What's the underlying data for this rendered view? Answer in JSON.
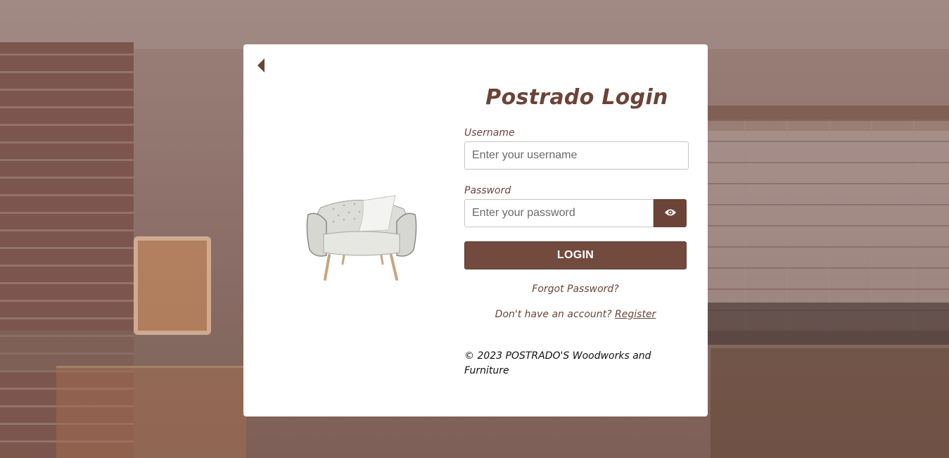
{
  "login": {
    "title": "Postrado Login",
    "username_label": "Username",
    "username_placeholder": "Enter your username",
    "password_label": "Password",
    "password_placeholder": "Enter your password",
    "submit_label": "LOGIN",
    "forgot_label": "Forgot Password?",
    "no_account_text": "Don't have an account?",
    "register_label": "Register",
    "copyright": "© 2023 POSTRADO'S Woodworks and Furniture"
  },
  "icons": {
    "back": "back-arrow-icon",
    "password_toggle": "eye-icon",
    "product": "armchair-image"
  },
  "colors": {
    "accent": "#6b4437",
    "button": "#734b3e",
    "card": "#ffffff"
  }
}
